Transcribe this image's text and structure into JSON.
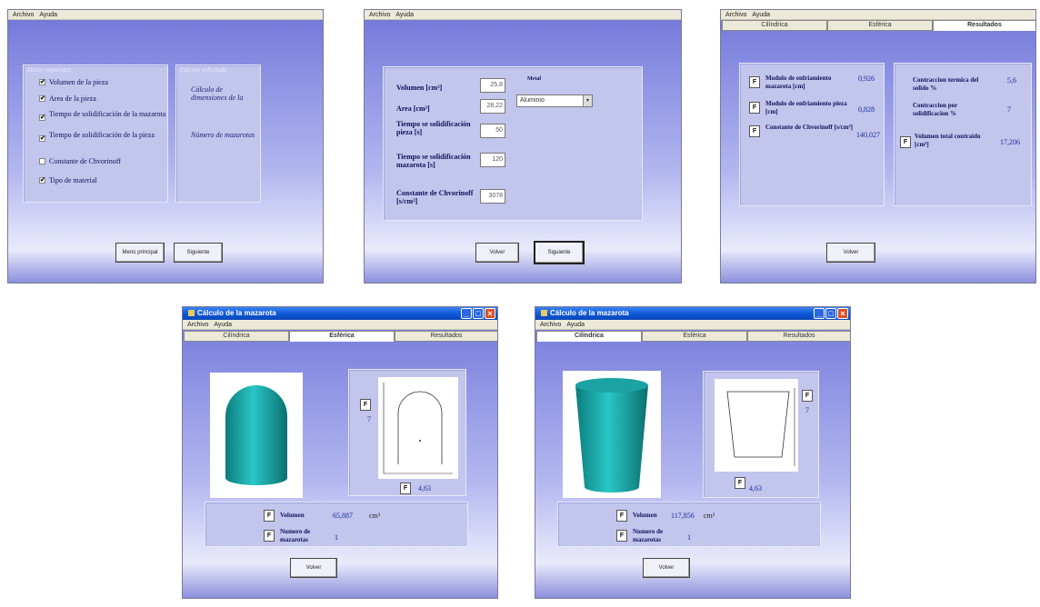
{
  "menu": {
    "archivo": "Archivo",
    "ayuda": "Ayuda"
  },
  "w1": {
    "panel_left_title": "Datos requeridos",
    "panel_right_title": "Cálculo solicitado",
    "checks": [
      {
        "label": "Volumen de la pieza",
        "checked": "✔"
      },
      {
        "label": "Area de la pieza",
        "checked": "✔"
      },
      {
        "label": "Tiempo de solidificación de la mazarota",
        "checked": "✔"
      },
      {
        "label": "Tiempo de solidificación de la pieza",
        "checked": "✔"
      },
      {
        "label": "Constante de Chvorinoff",
        "checked": ""
      },
      {
        "label": "Tipo de material",
        "checked": "✔"
      }
    ],
    "link1": "Cálculo de dimensiones de la",
    "link2": "Número de mazarotas",
    "btn_menu": "Menú principal",
    "btn_next": "Siguiente"
  },
  "w2": {
    "lbl_volumen": "Volumen [cm³]",
    "val_volumen": "25,8",
    "lbl_area": "Area [cm²]",
    "val_area": "28,22",
    "lbl_tpieza": "Tiempo se solidificación pieza [s]",
    "val_tpieza": "50",
    "lbl_tmaz": "Tiempo se solidificación mazarota [s]",
    "val_tmaz": "120",
    "lbl_const": "Constante de Chvorinoff [s/cm²]",
    "val_const": "3078",
    "metal_label": "Metal",
    "metal_value": "Aluminio",
    "btn_back": "Volver",
    "btn_next": "Siguiente"
  },
  "w3": {
    "tabs": [
      "Cilíndrica",
      "Esférica",
      "Resultados"
    ],
    "left": [
      {
        "label": "Modulo de enfriamiento mazarota [cm]",
        "value": "0,926"
      },
      {
        "label": "Modulo de enfriamiento pieza [cm]",
        "value": "0,828"
      },
      {
        "label": "Constante de Chvorinoff [s/cm²]",
        "value": "140,027"
      }
    ],
    "right": [
      {
        "label": "Contraccion termica del solido %",
        "value": "5,6"
      },
      {
        "label": "Contraccion por solidificacion %",
        "value": "7"
      },
      {
        "label": "Volumen total contraido [cm³]",
        "value": "17,206"
      }
    ],
    "btn_back": "Volver"
  },
  "w4": {
    "title": "Cálculo de la mazarota",
    "tabs": [
      "Cilíndrica",
      "Esférica",
      "Resultados"
    ],
    "dim_h": "7",
    "dim_w": "4,63",
    "vol_label": "Volumen",
    "vol_value": "65,887",
    "vol_unit": "cm³",
    "num_label": "Numero de mazarotas",
    "num_value": "1",
    "btn_back": "Volver"
  },
  "w5": {
    "title": "Cálculo de la mazarota",
    "tabs": [
      "Cilíndrica",
      "Esférica",
      "Resultados"
    ],
    "dim_h": "7",
    "dim_w": "4,63",
    "vol_label": "Volumen",
    "vol_value": "117,856",
    "vol_unit": "cm³",
    "num_label": "Numero de mazarotas",
    "num_value": "1",
    "btn_back": "Volver"
  },
  "colors": {
    "accent": "#7176d8",
    "panel": "#c2c5ec",
    "shape": "#1aa4a4",
    "title_bar": "#0d56d6"
  },
  "f_label": "F",
  "icons": {
    "min": "minimize-icon",
    "max": "maximize-icon",
    "close": "close-icon",
    "dropdown": "dropdown-arrow-icon",
    "check": "checkmark-icon"
  }
}
